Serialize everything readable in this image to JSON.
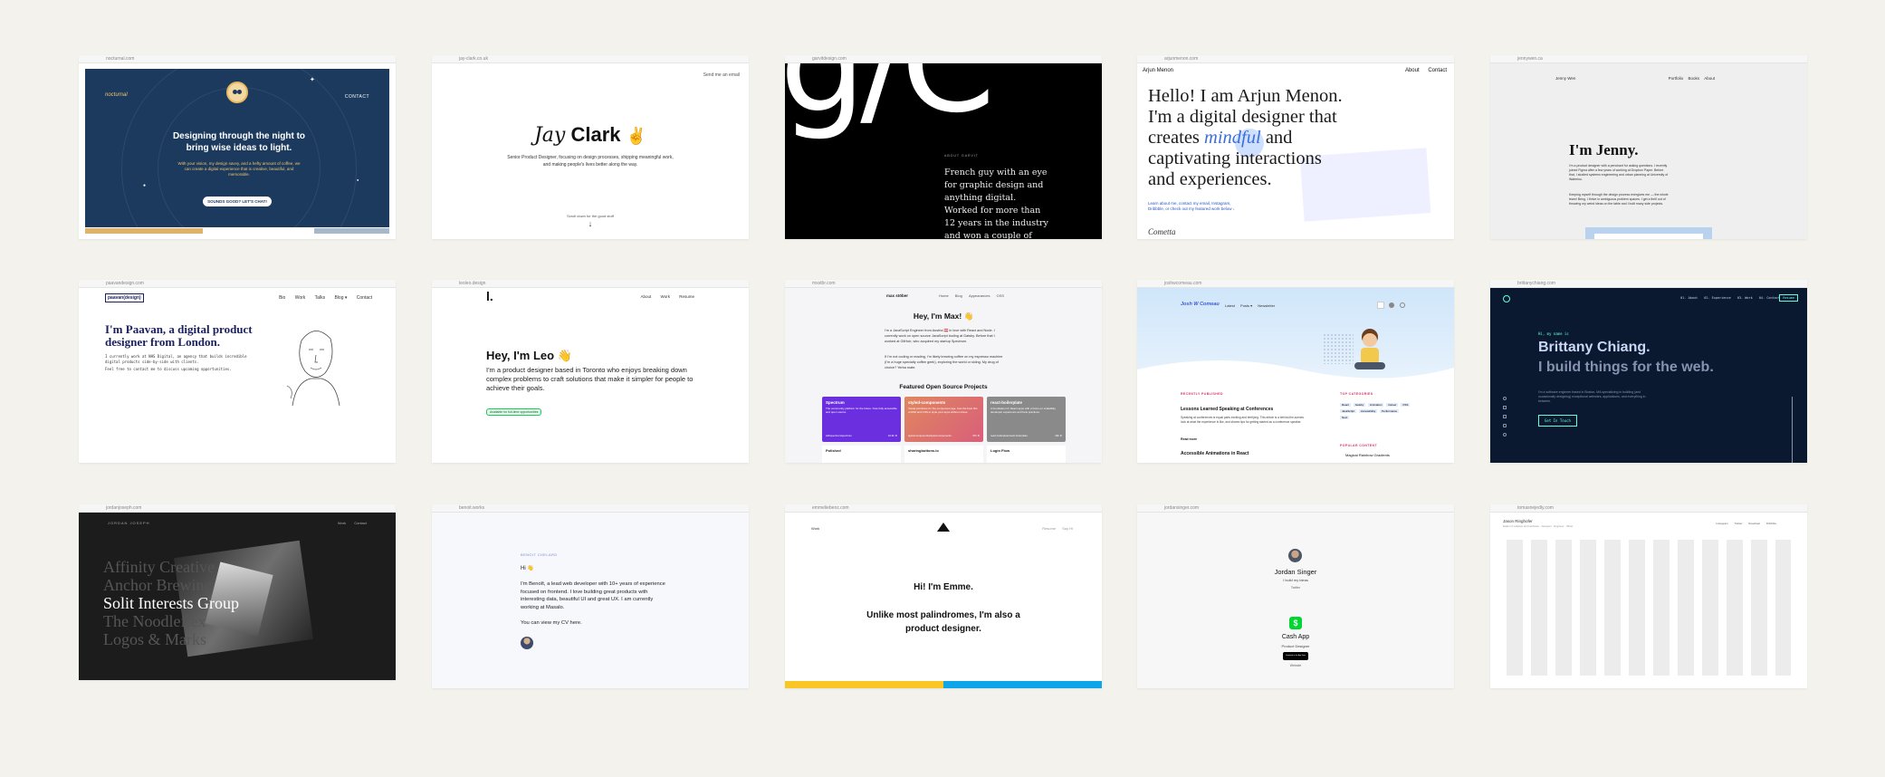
{
  "colors": {
    "page_bg": "#f3f2ed",
    "nocturne_navy": "#1c3a5e",
    "brittany_navy": "#0a192f",
    "brittany_accent": "#64ffda",
    "paavan_navy": "#1b1f5e",
    "leo_green": "#22c55e",
    "emme_yellow": "#f9c623",
    "emme_blue": "#0ea5e9"
  },
  "sites": {
    "s1": {
      "url": "nocturnal.com",
      "logo": "nocturnal",
      "contact": "CONTACT",
      "headline": "Designing through the night to bring wise ideas to light.",
      "body": "With your vision, my design savvy, and a hefty amount of coffee, we can create a digital experience that is creative, beautiful, and memorable.",
      "cta": "SOUNDS GOOD? LET'S CHAT!"
    },
    "s2": {
      "url": "jay-clark.co.uk",
      "corner": "Send me an email",
      "name_light": "Jay",
      "name_bold": "Clark",
      "emoji": "✌",
      "bio": "Senior Product Designer, focusing on design processes, shipping meaningful work, and making people's lives better along the way.",
      "scroll": "Scroll down for the good stuff",
      "arrow": "↓"
    },
    "s3": {
      "url": "garvitdesign.com",
      "big": "g/C",
      "label": "ABOUT GARVIT",
      "text": "French guy with an eye for graphic design and anything digital. Worked for more than 12 years in the industry and won a couple of awards."
    },
    "s4": {
      "url": "arjunmenon.com",
      "name": "Arjun Menon",
      "nav": [
        "About",
        "Contact"
      ],
      "line1": "Hello! I am Arjun Menon.",
      "line2": "I'm a digital designer that",
      "line3a": "creates",
      "line3b": "mindful",
      "line3c": "and",
      "line4": "captivating interactions",
      "line5": "and experiences.",
      "small": "Learn about me, contact my email, Instagram, Dribbble, or check out my featured work below ↓",
      "footer": "Cometta"
    },
    "s5": {
      "url": "jennywen.ca",
      "name": "Jenny Wen",
      "nav": [
        "Portfolio",
        "Books",
        "About"
      ],
      "title": "I'm Jenny.",
      "p1": "I'm a product designer with a penchant for asking questions. I recently joined Figma after a few years of working at Dropbox Paper. Before that, I studied systems engineering and urban planning at University of Waterloo.",
      "p2": "Keeping myself through the design process energizes me — the whole team! Bring, I thrive in ambiguous problem spaces. I get a thrill out of throwing my weird ideas on the table and I built many side projects."
    },
    "s6": {
      "url": "paavandesign.com",
      "logo": "paavan(design)",
      "nav": [
        "Bio",
        "Work",
        "Talks",
        "Blog ▾",
        "Contact"
      ],
      "title1": "I'm Paavan, a digital product",
      "title2": "designer from London.",
      "p1": "I currently work at NHS Digital, an agency that builds incredible digital products side-by-side with clients.",
      "p2": "Feel free to contact me to discuss upcoming opportunities."
    },
    "s7": {
      "url": "leoleo.design",
      "logo": "l.",
      "nav": [
        "About",
        "Work",
        "Resume"
      ],
      "title": "Hey, I'm Leo 👋",
      "bio": "I'm a product designer based in Toronto who enjoys breaking down complex problems to craft solutions that make it simpler for people to achieve their goals.",
      "badge": "Available for full-time opportunities"
    },
    "s8": {
      "url": "mxstbr.com",
      "logo": "max stöber",
      "nav": [
        "Home",
        "Blog",
        "Appearances",
        "OSS"
      ],
      "title": "Hey, I'm Max! 👋",
      "p1": "I'm a JavaScript Engineer from Austria 🇦🇹 in love with React and Node. I currently work on open source JavaScript tooling at Gatsby. Before that I worked at GitHub, who acquired my startup Spectrum.",
      "p2": "If I'm not coding or reading, I'm likely brewing coffee on my espresso machine (I'm a huge specialty coffee geek), exploring the world or skiing. My drug of choice? Yerba mate.",
      "section": "Featured Open Source Projects",
      "cards": [
        {
          "title": "Spectrum",
          "text": "The community platform for the future. Now fully accessible and open source.",
          "meta": "withspectrum/spectrum",
          "stars": "10.6k ★",
          "color": "#6b2fe0"
        },
        {
          "title": "styled-components",
          "text": "Visual primitives for the component age. Use the best bits of ES6 and CSS to style your apps without stress.",
          "meta": "styled-components/styled-components",
          "stars": "37k ★",
          "color": "#e06a5f"
        },
        {
          "title": "react-boilerplate",
          "text": "A foundation for React apps with a focus on scalability, developer experience and best practices.",
          "meta": "react-boilerplate/react-boilerplate",
          "stars": "29k ★",
          "color": "#8a8a8a"
        }
      ],
      "under": [
        "Polished",
        "sharingbuttons.io",
        "Login Flow"
      ]
    },
    "s9": {
      "url": "joshwcomeau.com",
      "logo": "Josh W Comeau",
      "nav": [
        "Latest",
        "Posts ▾",
        "Newsletter"
      ],
      "recent": "RECENTLY PUBLISHED",
      "post1": "Lessons Learned Speaking at Conferences",
      "post1_text": "Speaking at conferences is equal parts exciting and terrifying. This article is a behind-the-scenes look at what the experience is like, and shares tips for getting started as a conference speaker.",
      "read_more": "Read more",
      "post2": "Accessible Animations in React",
      "cats_title": "TOP CATEGORIES",
      "cats": [
        "React",
        "Gatsby",
        "Animation",
        "Career",
        "CSS",
        "JavaScript",
        "Accessibility",
        "Performance",
        "Next"
      ],
      "popular": "POPULAR CONTENT",
      "popular1": "Magical Rainbow Gradients"
    },
    "s10": {
      "url": "brittanychiang.com",
      "nav": [
        "01. About",
        "02. Experience",
        "03. Work",
        "04. Contact"
      ],
      "resume": "Resume",
      "hi": "Hi, my name is",
      "name": "Brittany Chiang.",
      "tag": "I build things for the web.",
      "bio": "I'm a software engineer based in Boston, MA specializing in building (and occasionally designing) exceptional websites, applications, and everything in between.",
      "cta": "Get In Touch"
    },
    "s11": {
      "url": "jordanjoseph.com",
      "name": "JORDAN JOSEPH",
      "nav": [
        "Work",
        "Contact"
      ],
      "lines": [
        "Affinity Creative",
        "Anchor Brewing",
        "Solit Interests Group",
        "The Noodleflex",
        "Logos & Marks"
      ]
    },
    "s12": {
      "url": "benoit.works",
      "name": "BENOIT CHELARD",
      "hi": "Hi 👋",
      "p1": "I'm Benoît, a lead web developer with 10+ years of experience focused on frontend. I love building great products with interesting data, beautiful UI and great UX. I am currently working at Masalo.",
      "p2": "You can view my CV here."
    },
    "s13": {
      "url": "emmeliebenz.com",
      "left": "Work",
      "right": [
        "Resume",
        "Say Hi"
      ],
      "hi": "Hi! I'm Emme.",
      "line1": "Unlike most palindromes, I'm also a",
      "line2": "product designer."
    },
    "s14": {
      "url": "jordansinger.com",
      "name": "Jordan Singer",
      "sub": "I build my ideas",
      "link": "Twitter",
      "app": "Cash App",
      "role": "Product Designer",
      "store": "Download on the App Store",
      "more": "Website"
    },
    "s15": {
      "url": "tomasnejedly.com",
      "title": "Jason Ringhofer",
      "sub": "Maker of software and hardware · Designer · Engineer · Writer",
      "nav": [
        "Instagram",
        "Twitter",
        "Readcast",
        "Dribbble"
      ]
    }
  }
}
